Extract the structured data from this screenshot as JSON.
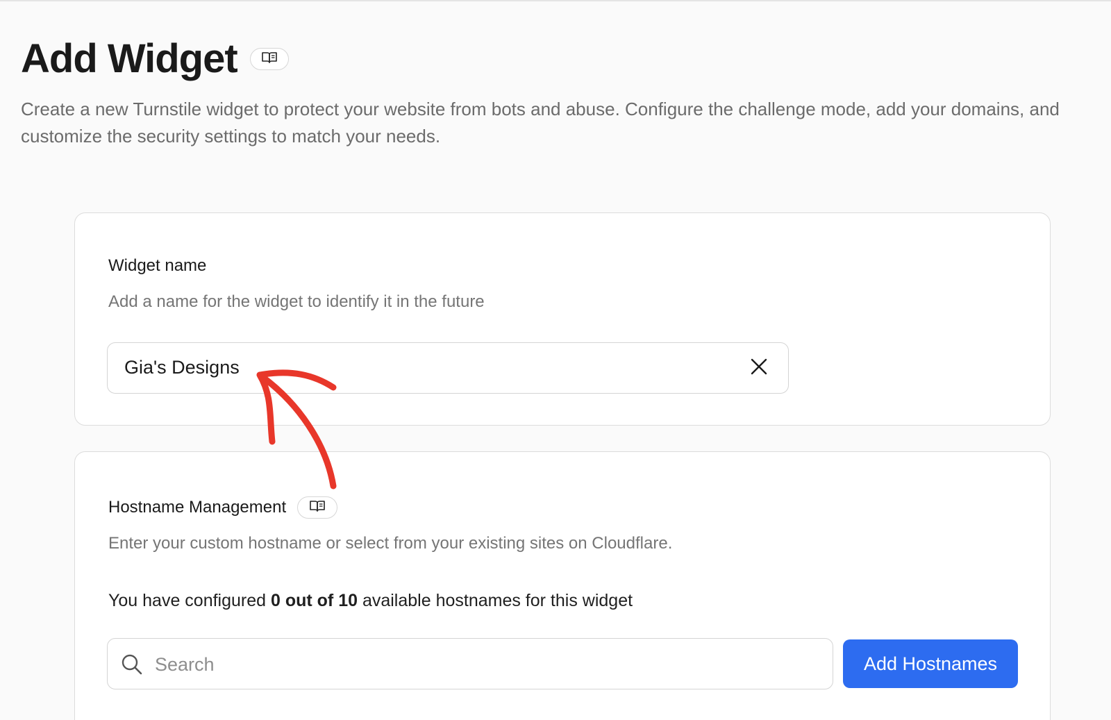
{
  "page": {
    "title": "Add Widget",
    "description": "Create a new Turnstile widget to protect your website from bots and abuse. Configure the challenge mode, add your domains, and customize the security settings to match your needs.",
    "doc_icon": "book-icon"
  },
  "widget_name": {
    "label": "Widget name",
    "help": "Add a name for the widget to identify it in the future",
    "value": "Gia's Designs",
    "clear_icon": "close-icon"
  },
  "hostname_management": {
    "label": "Hostname Management",
    "doc_icon": "book-icon",
    "help": "Enter your custom hostname or select from your existing sites on Cloudflare.",
    "count_prefix": "You have configured ",
    "count_bold": "0 out of 10",
    "count_suffix": " available hostnames for this widget",
    "search_placeholder": "Search",
    "search_icon": "search-icon",
    "add_button_label": "Add Hostnames"
  },
  "colors": {
    "primary_button": "#2d6cf0",
    "annotation_arrow": "#e8372a",
    "background": "#fafafa"
  }
}
